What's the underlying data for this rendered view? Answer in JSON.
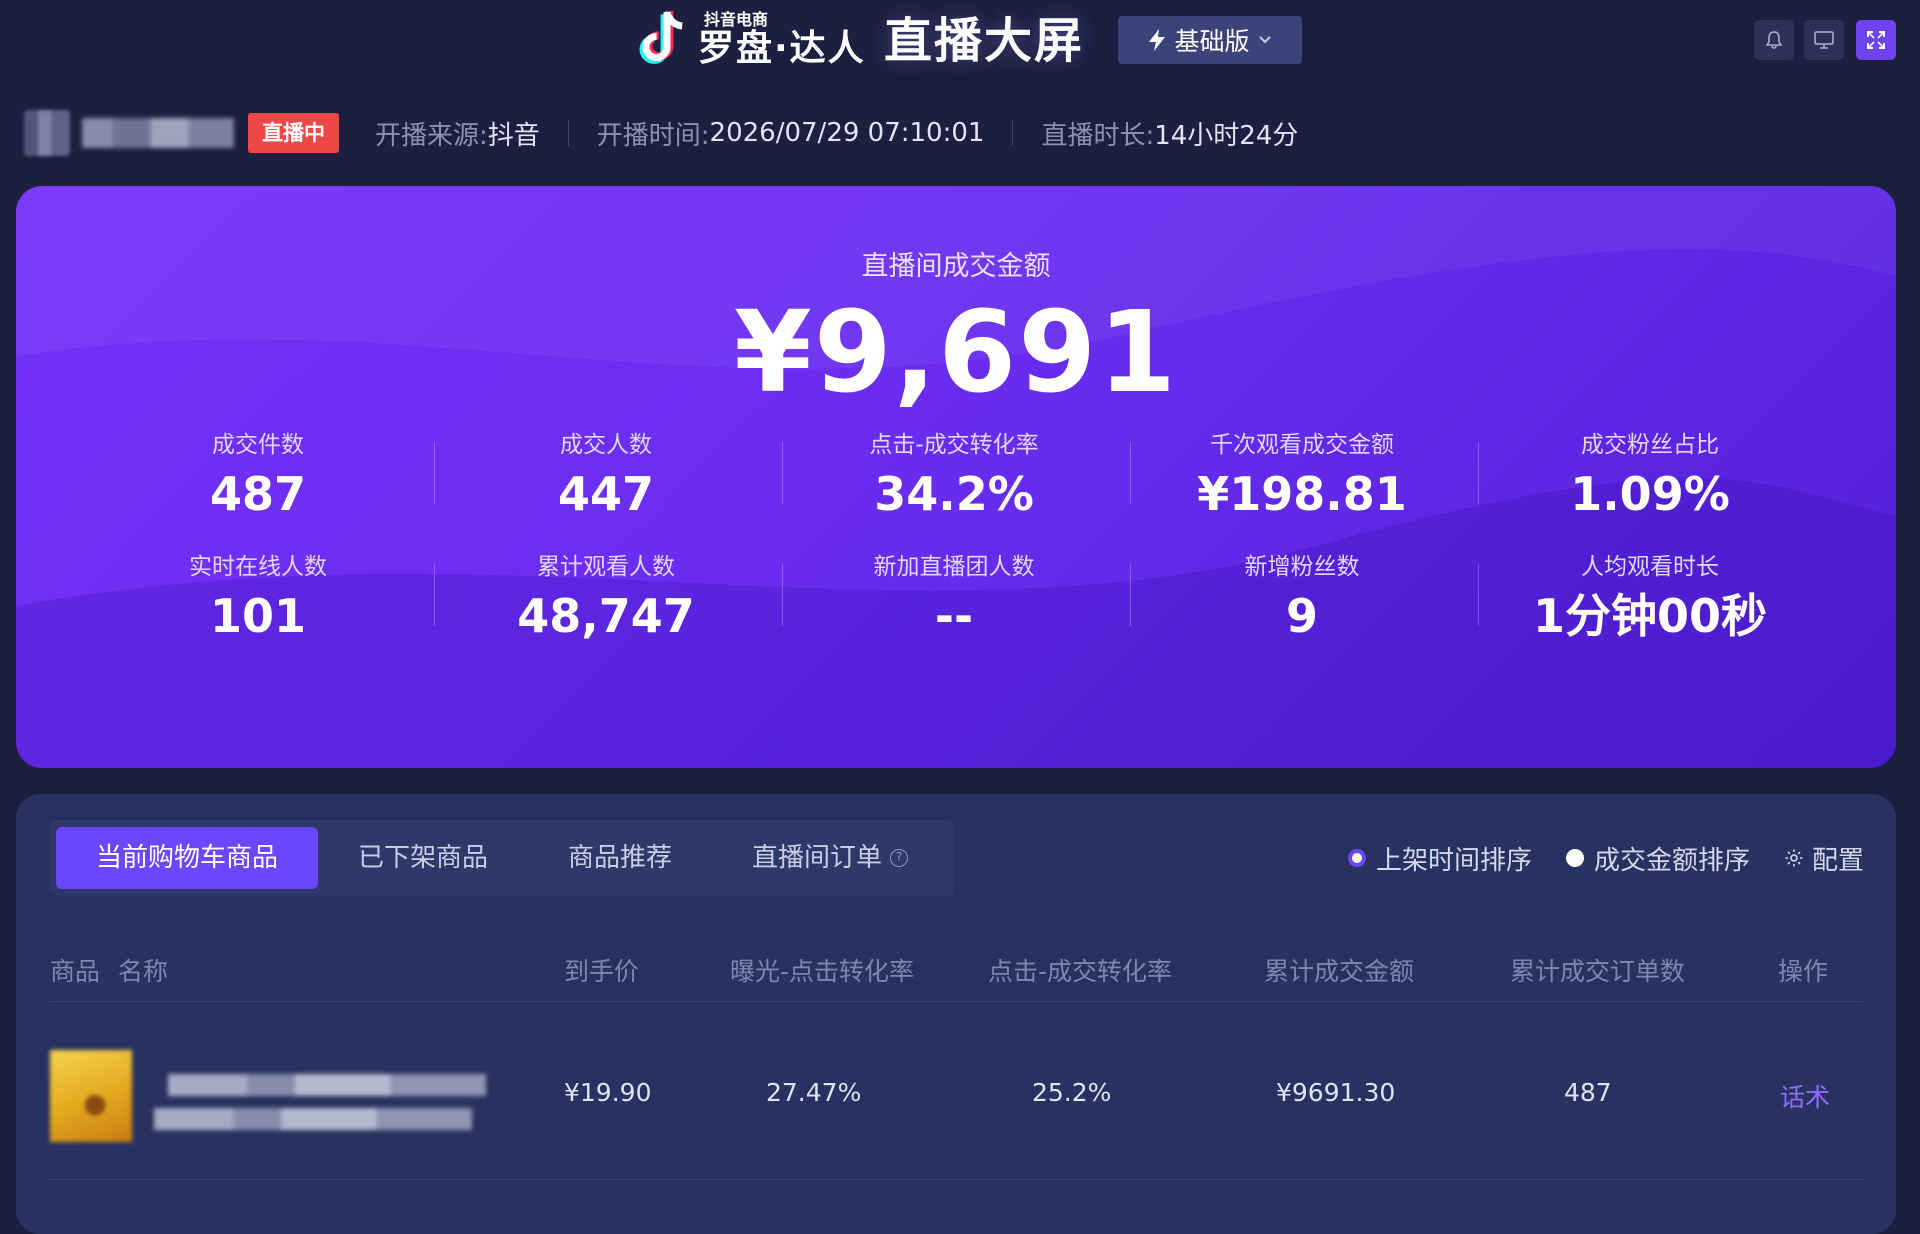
{
  "header": {
    "brand_sub": "抖音电商",
    "brand_main": "罗盘·达人",
    "page_title": "直播大屏",
    "version_label": "基础版",
    "icons": [
      "bell-icon",
      "monitor-icon",
      "fullscreen-icon"
    ]
  },
  "live_info": {
    "status_badge": "直播中",
    "source_label": "开播来源:",
    "source_value": "抖音",
    "start_label": "开播时间:",
    "start_value": "2026/07/29 07:10:01",
    "duration_label": "直播时长:",
    "duration_value": "14小时24分"
  },
  "hero": {
    "gmv_label": "直播间成交金额",
    "gmv_value": "¥9,691",
    "metrics_row1": [
      {
        "label": "成交件数",
        "value": "487"
      },
      {
        "label": "成交人数",
        "value": "447"
      },
      {
        "label": "点击-成交转化率",
        "value": "34.2%"
      },
      {
        "label": "千次观看成交金额",
        "value": "¥198.81"
      },
      {
        "label": "成交粉丝占比",
        "value": "1.09%"
      }
    ],
    "metrics_row2": [
      {
        "label": "实时在线人数",
        "value": "101"
      },
      {
        "label": "累计观看人数",
        "value": "48,747"
      },
      {
        "label": "新加直播团人数",
        "value": "--"
      },
      {
        "label": "新增粉丝数",
        "value": "9"
      },
      {
        "label": "人均观看时长",
        "value": "1分钟00秒"
      }
    ]
  },
  "products": {
    "tabs": [
      {
        "label": "当前购物车商品",
        "active": true
      },
      {
        "label": "已下架商品",
        "active": false
      },
      {
        "label": "商品推荐",
        "active": false
      },
      {
        "label": "直播间订单",
        "active": false
      }
    ],
    "sort_options": [
      {
        "label": "上架时间排序",
        "selected": true
      },
      {
        "label": "成交金额排序",
        "selected": false
      }
    ],
    "config_label": "配置",
    "columns": [
      "商品",
      "名称",
      "到手价",
      "曝光-点击转化率",
      "点击-成交转化率",
      "累计成交金额",
      "累计成交订单数",
      "操作"
    ],
    "rows": [
      {
        "price": "¥19.90",
        "exposure_click_rate": "27.47%",
        "click_deal_rate": "25.2%",
        "total_gmv": "¥9691.30",
        "total_orders": "487",
        "action": "话术"
      }
    ]
  },
  "colors": {
    "accent": "#6b48ff",
    "hero_gradient_start": "#7530f7",
    "hero_gradient_end": "#5420d9",
    "live_badge": "#f04747",
    "background": "#1c1f3f",
    "panel": "#283260"
  }
}
